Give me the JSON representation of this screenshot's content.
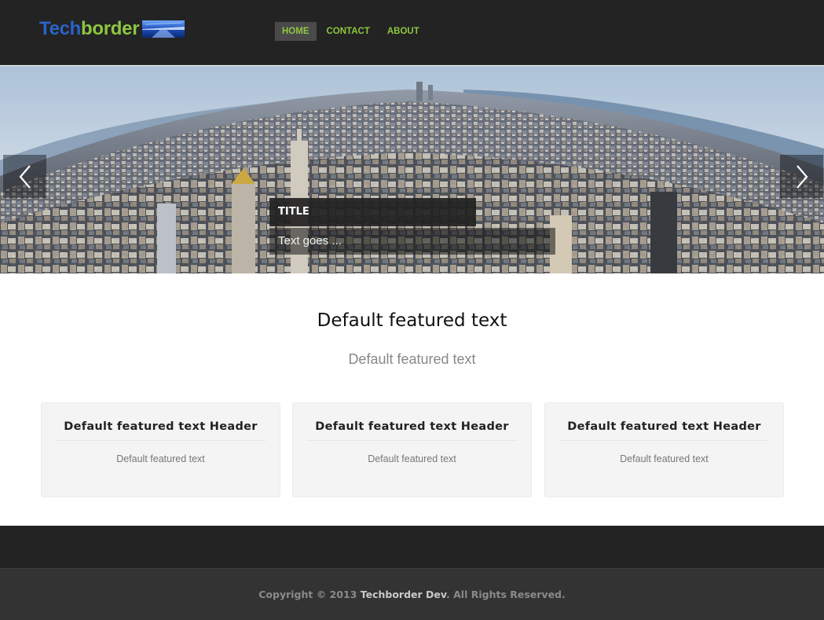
{
  "header": {
    "logo": {
      "part_a": "Tech",
      "part_b": "border"
    },
    "nav": [
      {
        "label": "HOME",
        "active": true
      },
      {
        "label": "CONTACT",
        "active": false
      },
      {
        "label": "ABOUT",
        "active": false
      }
    ]
  },
  "hero": {
    "image": "city-skyline-fisheye",
    "prev_icon": "chevron-left-icon",
    "next_icon": "chevron-right-icon",
    "caption_title": "TITLE",
    "caption_text": "Text goes ..."
  },
  "intro": {
    "title": "Default featured text",
    "subtitle": "Default featured text"
  },
  "features": [
    {
      "header": "Default featured text Header",
      "text": "Default featured text"
    },
    {
      "header": "Default featured text Header",
      "text": "Default featured text"
    },
    {
      "header": "Default featured text Header",
      "text": "Default featured text"
    }
  ],
  "footer": {
    "copyright_prefix": "Copyright © 2013 ",
    "copyright_brand": "Techborder Dev",
    "copyright_suffix": ". All Rights Reserved."
  },
  "colors": {
    "header_bg": "#232323",
    "accent_green": "#8dc63f",
    "logo_blue": "#2a64c9",
    "footer_bg": "#333333"
  }
}
